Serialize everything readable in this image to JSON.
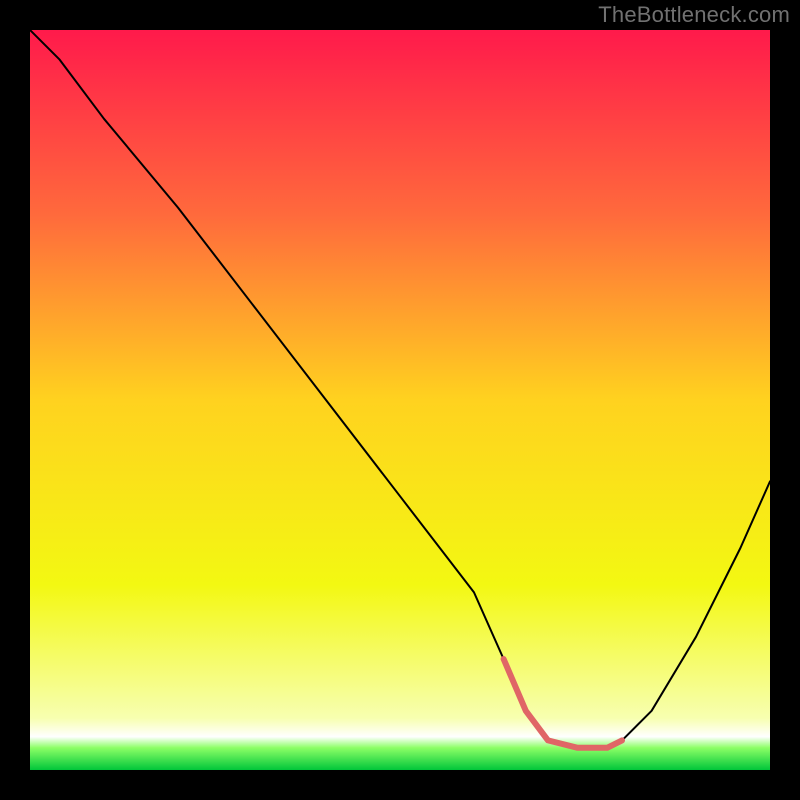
{
  "watermark": "TheBottleneck.com",
  "chart_data": {
    "type": "line",
    "title": "",
    "xlabel": "",
    "ylabel": "",
    "xlim": [
      0,
      100
    ],
    "ylim": [
      0,
      100
    ],
    "grid": false,
    "legend": false,
    "background_gradient": {
      "stops": [
        {
          "offset": 0.0,
          "color": "#ff1a4b"
        },
        {
          "offset": 0.25,
          "color": "#ff6a3c"
        },
        {
          "offset": 0.5,
          "color": "#ffd21f"
        },
        {
          "offset": 0.75,
          "color": "#f3f812"
        },
        {
          "offset": 0.93,
          "color": "#f7ffb0"
        },
        {
          "offset": 0.955,
          "color": "#ffffff"
        },
        {
          "offset": 0.97,
          "color": "#8cff66"
        },
        {
          "offset": 1.0,
          "color": "#00c63a"
        }
      ]
    },
    "series": [
      {
        "name": "bottleneck-curve",
        "stroke": "#000000",
        "stroke_width": 2,
        "x": [
          0,
          4,
          10,
          20,
          30,
          40,
          50,
          60,
          64,
          67,
          70,
          74,
          78,
          80,
          84,
          90,
          96,
          100
        ],
        "y": [
          100,
          96,
          88,
          76,
          63,
          50,
          37,
          24,
          15,
          8,
          4,
          3,
          3,
          4,
          8,
          18,
          30,
          39
        ]
      },
      {
        "name": "optimal-flat",
        "stroke": "#e06666",
        "stroke_width": 6,
        "x": [
          64,
          67,
          70,
          74,
          78,
          80
        ],
        "y": [
          15,
          8,
          4,
          3,
          3,
          4
        ]
      }
    ]
  }
}
